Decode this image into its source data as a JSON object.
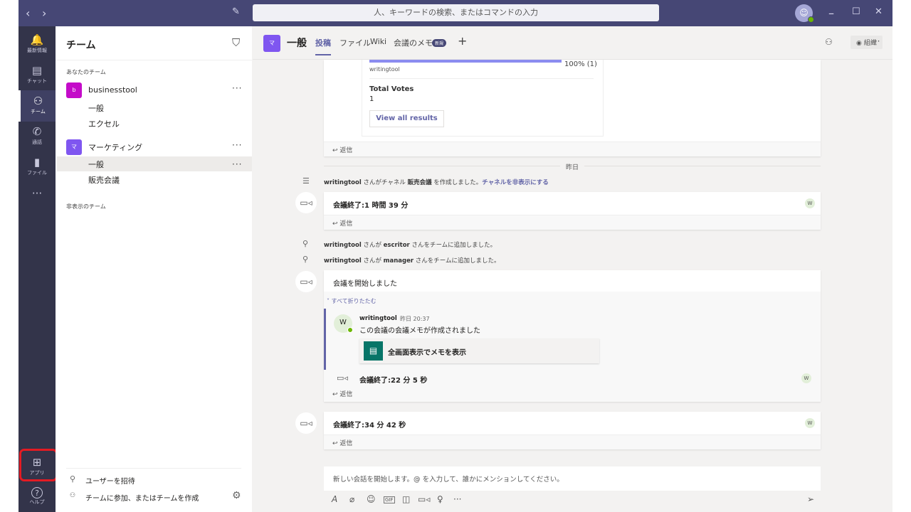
{
  "titlebar": {
    "back": "‹",
    "forward": "›",
    "compose_icon": "compose-icon",
    "search_placeholder": "人、キーワードの検索、またはコマンドの入力",
    "minimize": "–",
    "maximize": "☐",
    "close": "✕"
  },
  "rail": {
    "items": [
      {
        "label": "最新情報",
        "icon": "🔔"
      },
      {
        "label": "チャット",
        "icon": "▤"
      },
      {
        "label": "チーム",
        "icon": "⚇"
      },
      {
        "label": "通話",
        "icon": "✆"
      },
      {
        "label": "ファイル",
        "icon": "▮"
      },
      {
        "label": "",
        "icon": "···"
      }
    ],
    "apps": {
      "label": "アプリ",
      "icon": "⊞"
    },
    "help": {
      "label": "ヘルプ",
      "icon": "?"
    }
  },
  "teampane": {
    "title": "チーム",
    "your_teams": "あなたのチーム",
    "hidden_teams": "非表示のチーム",
    "teams": [
      {
        "name": "businesstool",
        "initial": "b",
        "color": "#c40bc9",
        "channels": [
          "一般",
          "エクセル"
        ]
      },
      {
        "name": "マーケティング",
        "initial": "マ",
        "color": "#7f56f0",
        "channels": [
          "一般",
          "販売会議"
        ]
      }
    ],
    "invite": "ユーザーを招待",
    "join": "チームに参加、またはチームを作成"
  },
  "channel": {
    "name": "一般",
    "tabs": [
      "投稿",
      "ファイル",
      "Wiki",
      "会議のメモ"
    ],
    "badge": "新規",
    "add": "+",
    "org_button": "組織"
  },
  "feed": {
    "poll": {
      "percent_label": "100% (1)",
      "fill": 1.0,
      "option": "writingtool",
      "total_votes_label": "Total Votes",
      "total_votes": "1",
      "view_all": "View all results"
    },
    "reply": "返信",
    "date_divider": "昨日",
    "channel_created": {
      "user": "writingtool",
      "text1": "さんがチャネル",
      "channel": "販売会議",
      "text2": "を作成しました。",
      "link": "チャネルを非表示にする"
    },
    "meeting1": {
      "title": "会議終了:1 時間 39 分",
      "badge": "W"
    },
    "added": [
      {
        "user": "writingtool",
        "text1": "さんが",
        "target": "escritor",
        "text2": "さんをチームに追加しました。"
      },
      {
        "user": "writingtool",
        "text1": "さんが",
        "target": "manager",
        "text2": "さんをチームに追加しました。"
      }
    ],
    "meeting2": {
      "title": "会議を開始しました",
      "collapse": "すべて折りたたむ",
      "author": "writingtool",
      "time": "昨日 20:37",
      "avatar": "W",
      "message": "この会議の会議メモが作成されました",
      "notes_button": "全画面表示でメモを表示",
      "ended": "会議終了:22 分 5 秒",
      "badge": "W"
    },
    "meeting3": {
      "title": "会議終了:34 分 42 秒",
      "badge": "W"
    }
  },
  "compose": {
    "placeholder": "新しい会話を開始します。@ を入力して、誰かにメンションしてください。"
  },
  "colors": {
    "titlebar": "#464775",
    "rail": "#33344a",
    "accent": "#6264a7"
  }
}
